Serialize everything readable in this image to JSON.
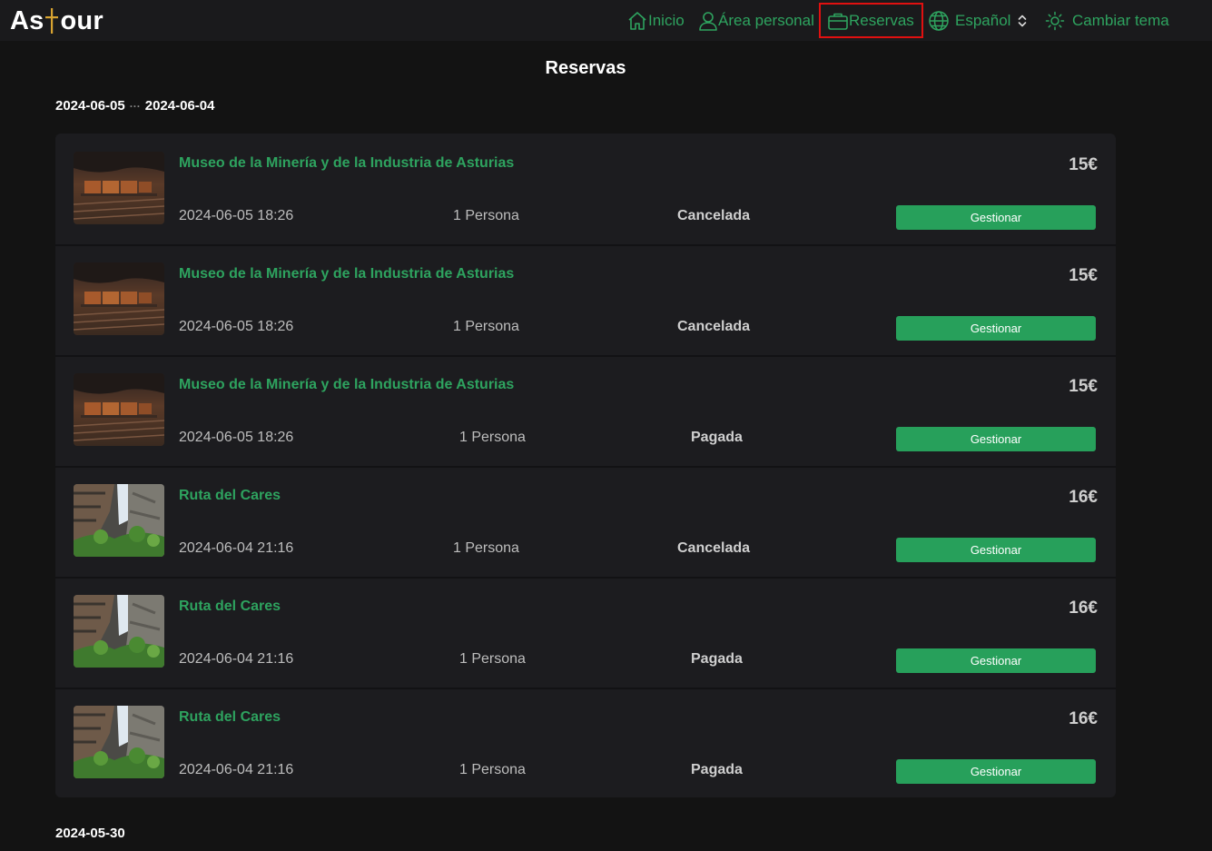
{
  "app": {
    "logo_text_left": "As",
    "logo_text_right": "our"
  },
  "nav": {
    "home": "Inicio",
    "personal": "Área personal",
    "bookings": "Reservas",
    "language": "Español",
    "theme": "Cambiar tema"
  },
  "page": {
    "title": "Reservas"
  },
  "groups": [
    {
      "date_from": "2024-06-05",
      "separator": "···",
      "date_to": "2024-06-04"
    },
    {
      "date_from": "2024-05-30"
    }
  ],
  "bookings": [
    {
      "title": "Museo de la Minería y de la Industria de Asturias",
      "price": "15€",
      "datetime": "2024-06-05 18:26",
      "people": "1 Persona",
      "status": "Cancelada",
      "action": "Gestionar",
      "image": "mine"
    },
    {
      "title": "Museo de la Minería y de la Industria de Asturias",
      "price": "15€",
      "datetime": "2024-06-05 18:26",
      "people": "1 Persona",
      "status": "Cancelada",
      "action": "Gestionar",
      "image": "mine"
    },
    {
      "title": "Museo de la Minería y de la Industria de Asturias",
      "price": "15€",
      "datetime": "2024-06-05 18:26",
      "people": "1 Persona",
      "status": "Pagada",
      "action": "Gestionar",
      "image": "mine"
    },
    {
      "title": "Ruta del Cares",
      "price": "16€",
      "datetime": "2024-06-04 21:16",
      "people": "1 Persona",
      "status": "Cancelada",
      "action": "Gestionar",
      "image": "gorge"
    },
    {
      "title": "Ruta del Cares",
      "price": "16€",
      "datetime": "2024-06-04 21:16",
      "people": "1 Persona",
      "status": "Pagada",
      "action": "Gestionar",
      "image": "gorge"
    },
    {
      "title": "Ruta del Cares",
      "price": "16€",
      "datetime": "2024-06-04 21:16",
      "people": "1 Persona",
      "status": "Pagada",
      "action": "Gestionar",
      "image": "gorge"
    }
  ],
  "colors": {
    "accent": "#2ea35f",
    "button": "#27a05b",
    "background": "#131313",
    "card": "#1c1c1f",
    "active_outline": "#e01010",
    "logo_cross": "#d8a431"
  },
  "icons": {
    "home": "home-icon",
    "personal": "user-icon",
    "bookings": "briefcase-icon",
    "language": "globe-icon",
    "language_chevron": "chevron-updown-icon",
    "theme": "sun-icon"
  }
}
